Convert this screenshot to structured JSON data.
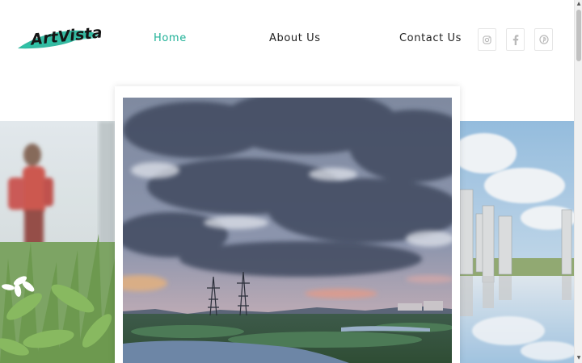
{
  "brand": {
    "logo_text": "ArtVista",
    "accent_color": "#1fb197"
  },
  "nav": {
    "items": [
      {
        "label": "Home",
        "active": true
      },
      {
        "label": "About Us",
        "active": false
      },
      {
        "label": "Contact Us",
        "active": false
      }
    ]
  },
  "social": [
    {
      "icon": "instagram-icon",
      "glyph": "◎"
    },
    {
      "icon": "facebook-icon",
      "glyph": "f"
    },
    {
      "icon": "pinterest-icon",
      "glyph": "℗"
    }
  ],
  "gallery": {
    "left_image": "woman-with-flowers-photo",
    "center_image": "cloudy-sky-power-towers-photo",
    "right_image": "buildings-reflection-photo"
  }
}
